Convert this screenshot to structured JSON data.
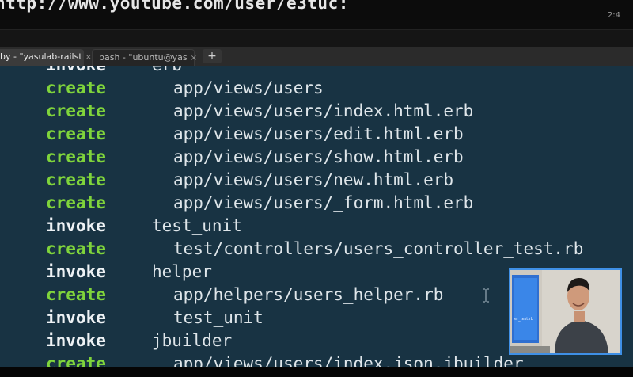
{
  "url_bar": {
    "text": "http://www.youtube.com/user/e3tuc:"
  },
  "clock": {
    "text": "2:4"
  },
  "tabs": [
    {
      "label": "by - \"yasulab-railst",
      "close": "×"
    },
    {
      "label": "bash - \"ubuntu@yas",
      "close": "×"
    }
  ],
  "new_tab": {
    "label": "+"
  },
  "terminal": {
    "lines": [
      {
        "verb": "invoke",
        "arg": "erb",
        "indent": 1
      },
      {
        "verb": "create",
        "arg": "app/views/users",
        "indent": 2
      },
      {
        "verb": "create",
        "arg": "app/views/users/index.html.erb",
        "indent": 2
      },
      {
        "verb": "create",
        "arg": "app/views/users/edit.html.erb",
        "indent": 2
      },
      {
        "verb": "create",
        "arg": "app/views/users/show.html.erb",
        "indent": 2
      },
      {
        "verb": "create",
        "arg": "app/views/users/new.html.erb",
        "indent": 2
      },
      {
        "verb": "create",
        "arg": "app/views/users/_form.html.erb",
        "indent": 2
      },
      {
        "verb": "invoke",
        "arg": "test_unit",
        "indent": 1
      },
      {
        "verb": "create",
        "arg": "test/controllers/users_controller_test.rb",
        "indent": 2
      },
      {
        "verb": "invoke",
        "arg": "helper",
        "indent": 1
      },
      {
        "verb": "create",
        "arg": "app/helpers/users_helper.rb",
        "indent": 2
      },
      {
        "verb": "invoke",
        "arg": "test_unit",
        "indent": 2
      },
      {
        "verb": "invoke",
        "arg": "jbuilder",
        "indent": 1
      },
      {
        "verb": "create",
        "arg": "app/views/users/index.json.jbuilder",
        "indent": 2
      }
    ]
  },
  "pip": {
    "screen_text": "er_test.rb"
  },
  "colors": {
    "terminal_bg": "#183343",
    "create": "#7fd43b",
    "invoke": "#eef2f5",
    "path": "#dfe6ea",
    "pip_border": "#3f90e6"
  }
}
